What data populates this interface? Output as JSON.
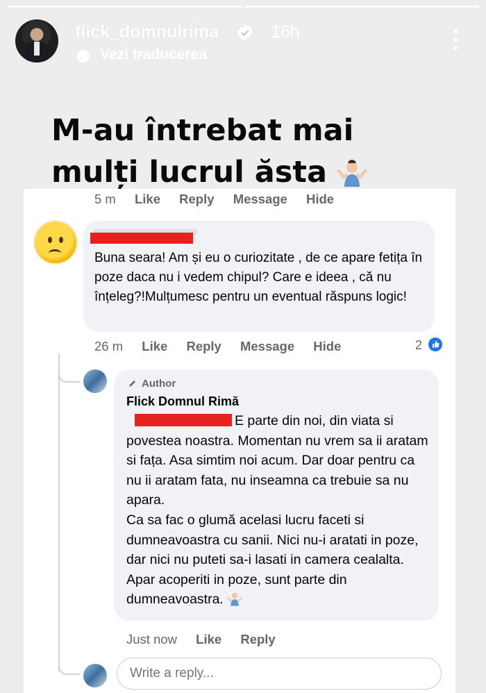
{
  "story": {
    "username": "flick_domnulrima",
    "time_ago": "16h",
    "translate_label": "Vezi traducerea",
    "caption": "M-au întrebat mai mulți lucrul ăsta",
    "icons": [
      "verified-badge-icon",
      "translate-icon",
      "more-options-icon",
      "shrug-emoji-icon"
    ]
  },
  "post_actions": {
    "time": "5 m",
    "like": "Like",
    "reply": "Reply",
    "message": "Message",
    "hide": "Hide"
  },
  "comment": {
    "text": "Buna seara! Am și eu o curiozitate , de ce apare fetița  în poze daca nu i vedem chipul? Care e ideea , că nu înțeleg?!Mulțumesc pentru un eventual răspuns logic!",
    "time": "26 m",
    "like": "Like",
    "reply": "Reply",
    "message": "Message",
    "hide": "Hide",
    "reaction_count": "2"
  },
  "reply": {
    "badge": "Author",
    "author": "Flick Domnul Rimă",
    "text": "E parte din noi, din viata si povestea noastra. Momentan nu vrem sa ii aratam si fața. Asa simtim noi acum. Dar doar pentru ca nu ii aratam fata, nu inseamna ca trebuie sa nu apara.",
    "text2": "Ca sa fac o glumă acelasi lucru faceti si dumneavoastra cu sanii. Nici nu-i aratati in poze, dar nici nu puteti sa-i lasati in camera cealalta. Apar acoperiti in poze, sunt parte din dumneavoastra.",
    "time": "Just now",
    "like": "Like",
    "reply": "Reply"
  },
  "input": {
    "placeholder": "Write a reply..."
  },
  "colors": {
    "redaction": "#e8201f",
    "like_blue": "#1877f2",
    "bubble": "#f0f2f5"
  }
}
